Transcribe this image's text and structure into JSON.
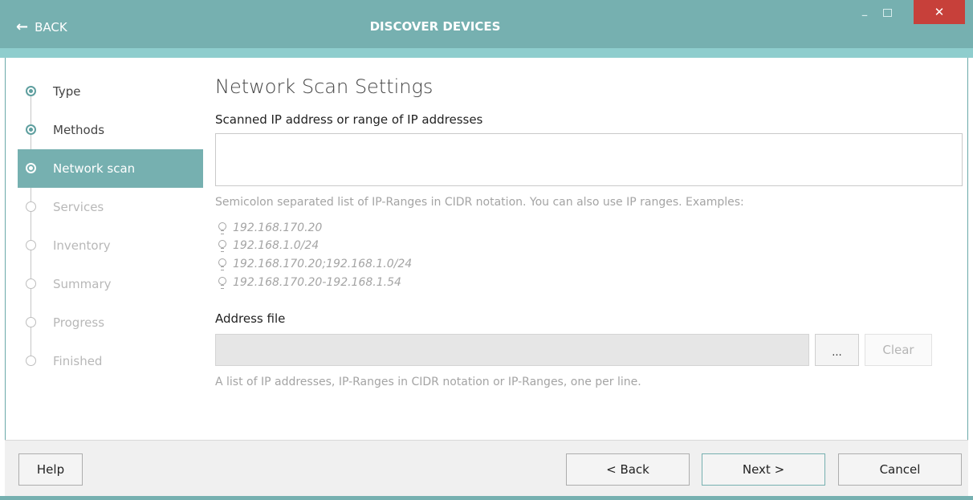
{
  "titlebar": {
    "back_label": "BACK",
    "back_icon": "left-arrow",
    "title": "DISCOVER DEVICES",
    "minimize_glyph": "–",
    "close_glyph": "✕"
  },
  "steps": [
    {
      "label": "Type",
      "state": "done"
    },
    {
      "label": "Methods",
      "state": "done"
    },
    {
      "label": "Network scan",
      "state": "active"
    },
    {
      "label": "Services",
      "state": "pending"
    },
    {
      "label": "Inventory",
      "state": "pending"
    },
    {
      "label": "Summary",
      "state": "pending"
    },
    {
      "label": "Progress",
      "state": "pending"
    },
    {
      "label": "Finished",
      "state": "pending"
    }
  ],
  "main": {
    "heading": "Network Scan Settings",
    "ip_label": "Scanned IP address or range of IP addresses",
    "ip_value": "",
    "ip_hint": "Semicolon separated list of IP-Ranges in CIDR notation. You can also use IP ranges. Examples:",
    "examples": [
      "192.168.170.20",
      "192.168.1.0/24",
      "192.168.170.20;192.168.1.0/24",
      "192.168.170.20-192.168.1.54"
    ],
    "address_file_label": "Address file",
    "address_file_value": "",
    "browse_label": "...",
    "clear_label": "Clear",
    "address_file_hint": "A list of IP addresses, IP-Ranges in CIDR notation or IP-Ranges, one per line."
  },
  "footer": {
    "help_label": "Help",
    "back_label": "< Back",
    "next_label": "Next >",
    "cancel_label": "Cancel"
  },
  "colors": {
    "accent": "#76b0b0",
    "accent_light": "#8ecdcd",
    "close_red": "#c7403a",
    "hint_gray": "#a4a4a4"
  }
}
